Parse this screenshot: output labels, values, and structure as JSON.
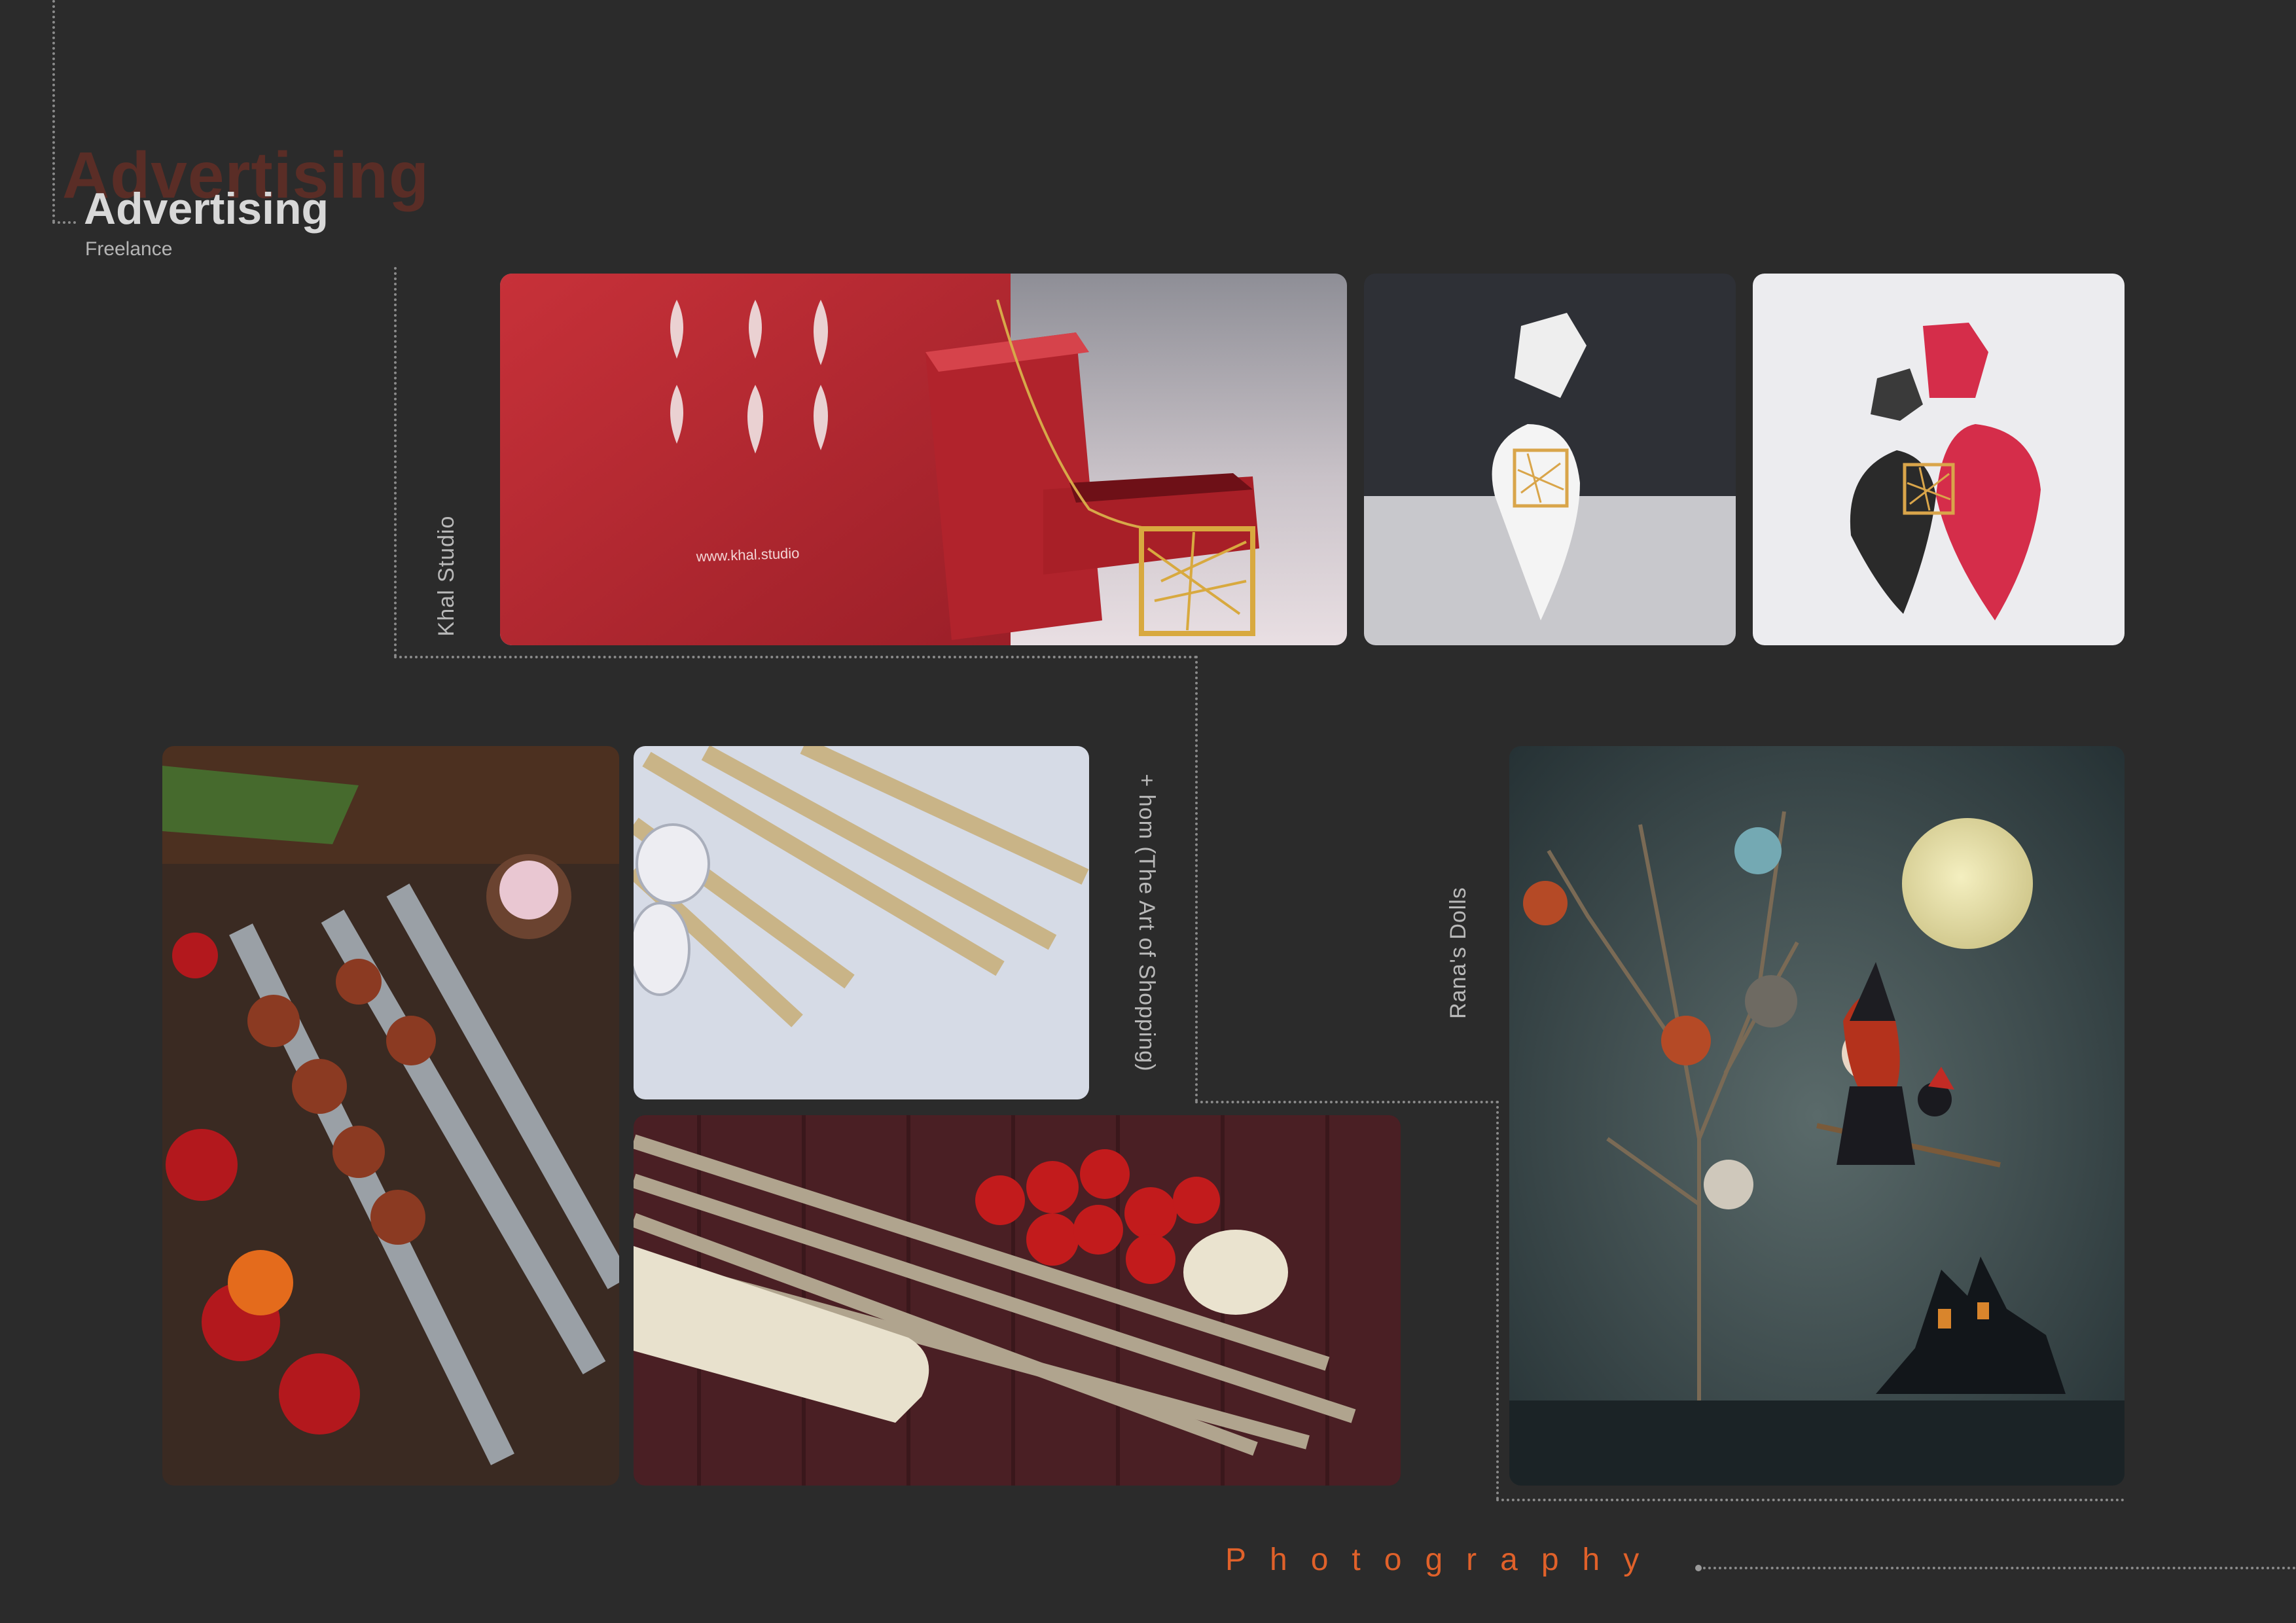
{
  "header": {
    "ghost_title": "Advertising",
    "title": "Advertising",
    "subtitle": "Freelance"
  },
  "projects": [
    {
      "label": "Khal Studio"
    },
    {
      "label": "+ hom   (The Art of Shopping)"
    },
    {
      "label": "Rana's Dolls"
    }
  ],
  "photos": {
    "khal_box": {
      "text": "www.khal.studio"
    }
  },
  "footer": {
    "title": "Photography"
  },
  "colors": {
    "background": "#2b2b2b",
    "accent": "#e0612a",
    "ghost": "#5a2d26"
  }
}
